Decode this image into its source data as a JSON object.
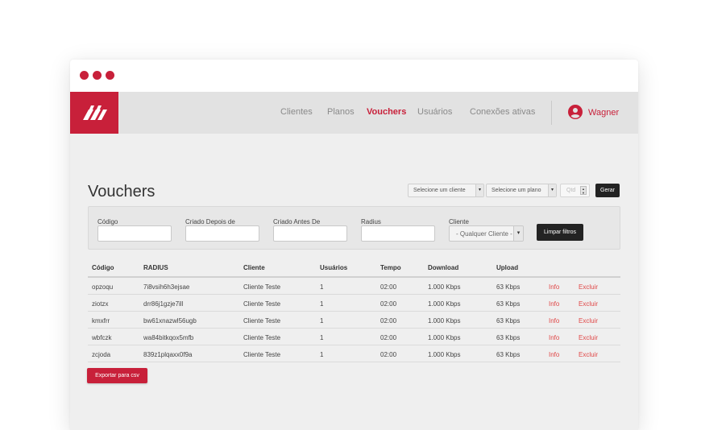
{
  "window": {
    "dots": [
      "dot",
      "dot",
      "dot"
    ]
  },
  "brand": {
    "logo_icon": "brand-logo-icon",
    "accent_color": "#c8203a"
  },
  "nav": {
    "items": [
      {
        "label": "Clientes",
        "active": false
      },
      {
        "label": "Planos",
        "active": false
      },
      {
        "label": "Vouchers",
        "active": true
      },
      {
        "label": "Usuários",
        "active": false
      },
      {
        "label": "Conexões ativas",
        "active": false
      }
    ],
    "user": {
      "icon": "user-account-icon",
      "name": "Wagner"
    }
  },
  "page": {
    "title": "Vouchers"
  },
  "generate": {
    "client_select": "Selecione um cliente",
    "plan_select": "Selecione um plano",
    "qty_placeholder": "Qtd",
    "button": "Gerar"
  },
  "filters": {
    "codigo_label": "Código",
    "criado_depois_label": "Criado Depois de",
    "criado_antes_label": "Criado Antes De",
    "radius_label": "Radius",
    "cliente_label": "Cliente",
    "cliente_value": "- Qualquer Cliente -",
    "clear_button": "Limpar filtros"
  },
  "table": {
    "columns": [
      "Código",
      "RADIUS",
      "Cliente",
      "Usuários",
      "Tempo",
      "Download",
      "Upload"
    ],
    "rows": [
      {
        "codigo": "opzoqu",
        "radius": "7i8vsih6h3ejsae",
        "cliente": "Cliente Teste",
        "usuarios": "1",
        "tempo": "02:00",
        "download": "1.000 Kbps",
        "upload": "63 Kbps",
        "info": "Info",
        "excluir": "Excluir"
      },
      {
        "codigo": "ziotzx",
        "radius": "drr86j1gzje7ill",
        "cliente": "Cliente Teste",
        "usuarios": "1",
        "tempo": "02:00",
        "download": "1.000 Kbps",
        "upload": "63 Kbps",
        "info": "Info",
        "excluir": "Excluir"
      },
      {
        "codigo": "kmxfrr",
        "radius": "bw61xnazwl56ugb",
        "cliente": "Cliente Teste",
        "usuarios": "1",
        "tempo": "02:00",
        "download": "1.000 Kbps",
        "upload": "63 Kbps",
        "info": "Info",
        "excluir": "Excluir"
      },
      {
        "codigo": "wbfczk",
        "radius": "wa84bitkqox5mfb",
        "cliente": "Cliente Teste",
        "usuarios": "1",
        "tempo": "02:00",
        "download": "1.000 Kbps",
        "upload": "63 Kbps",
        "info": "Info",
        "excluir": "Excluir"
      },
      {
        "codigo": "zcjoda",
        "radius": "839z1plqaxx0f9a",
        "cliente": "Cliente Teste",
        "usuarios": "1",
        "tempo": "02:00",
        "download": "1.000 Kbps",
        "upload": "63 Kbps",
        "info": "Info",
        "excluir": "Excluir"
      }
    ]
  },
  "export_button": "Exportar para csv"
}
